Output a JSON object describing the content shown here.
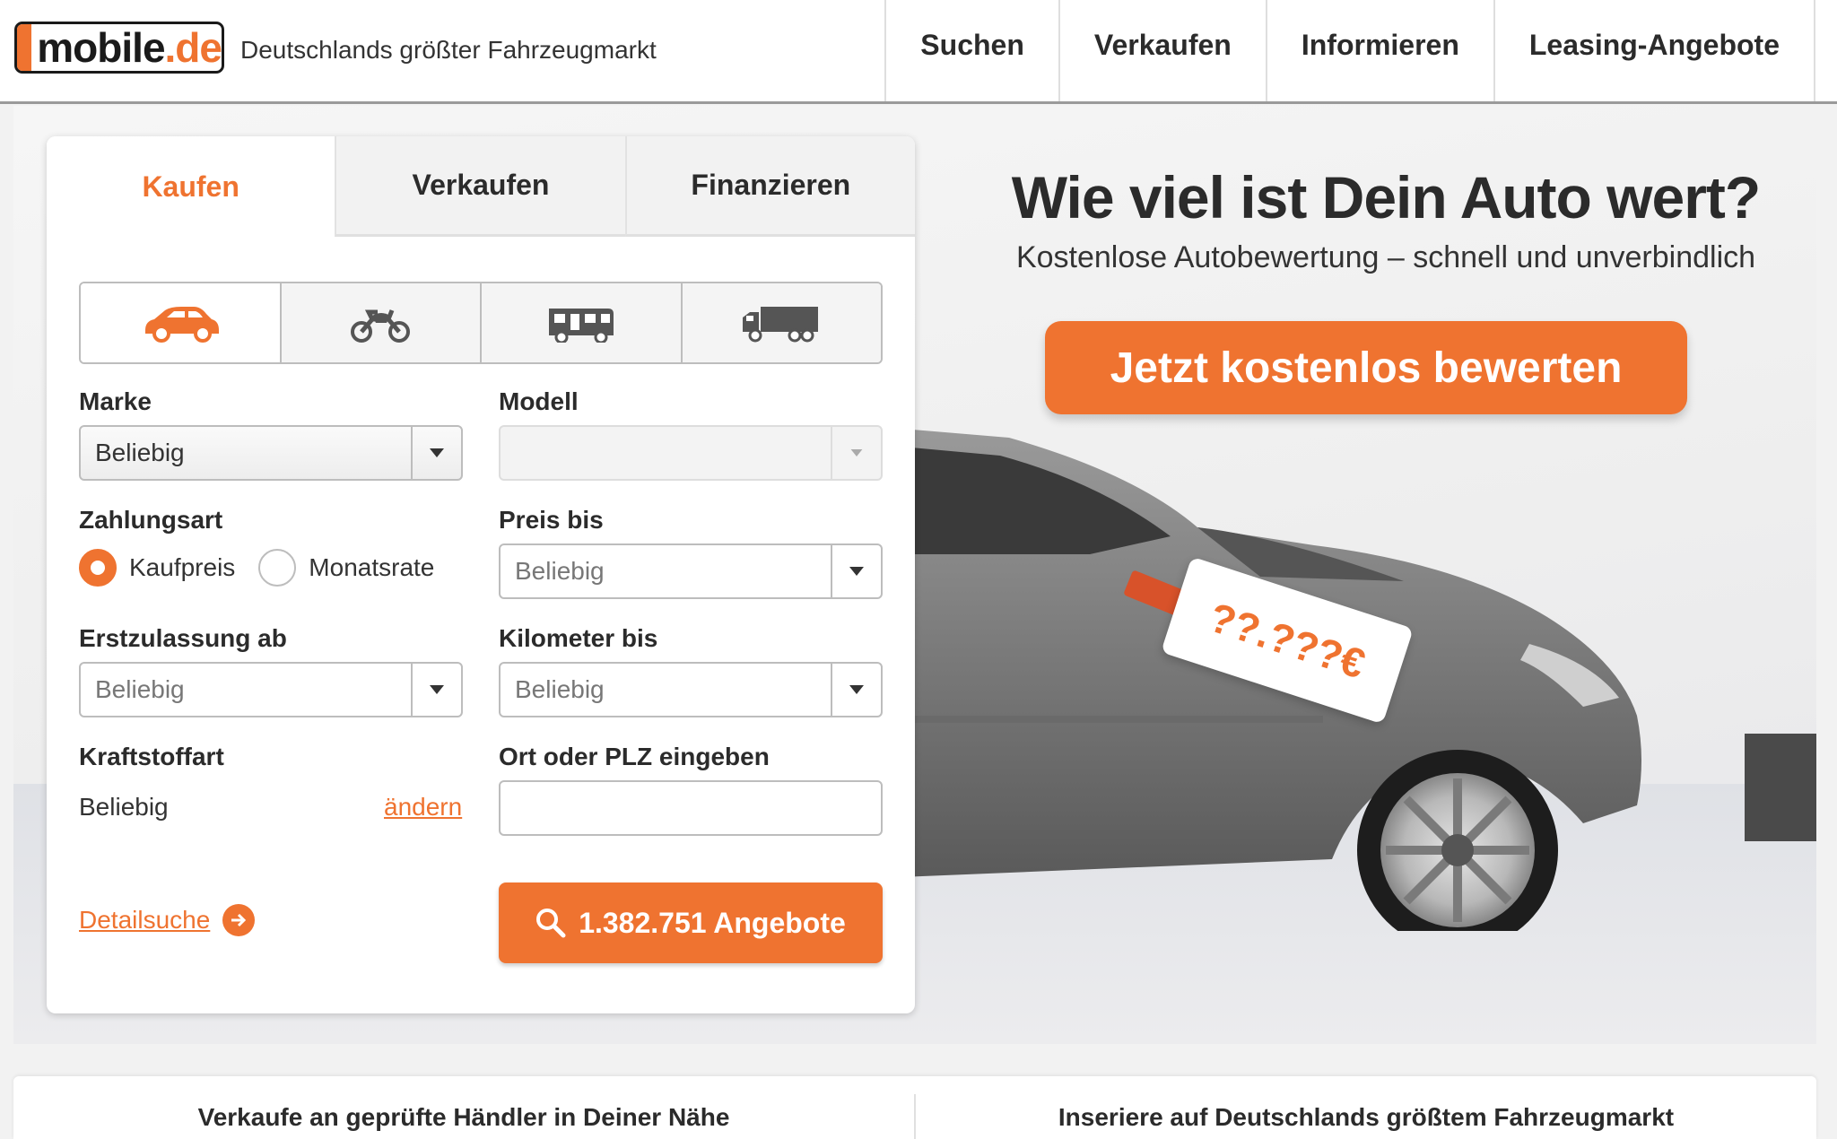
{
  "header": {
    "logo_main": "mobile",
    "logo_dot": ".de",
    "tagline": "Deutschlands größter Fahrzeugmarkt",
    "nav": [
      "Suchen",
      "Verkaufen",
      "Informieren",
      "Leasing-Angebote"
    ]
  },
  "search": {
    "tabs": [
      "Kaufen",
      "Verkaufen",
      "Finanzieren"
    ],
    "active_tab": "Kaufen",
    "vehicle_types": [
      "car-icon",
      "motorcycle-icon",
      "motorhome-icon",
      "truck-icon"
    ],
    "marke": {
      "label": "Marke",
      "value": "Beliebig"
    },
    "modell": {
      "label": "Modell",
      "value": ""
    },
    "zahlungsart": {
      "label": "Zahlungsart",
      "options": [
        "Kaufpreis",
        "Monatsrate"
      ],
      "selected": "Kaufpreis"
    },
    "preis": {
      "label": "Preis bis",
      "value": "Beliebig"
    },
    "erstzulassung": {
      "label": "Erstzulassung ab",
      "value": "Beliebig"
    },
    "kilometer": {
      "label": "Kilometer bis",
      "value": "Beliebig"
    },
    "kraftstoff": {
      "label": "Kraftstoffart",
      "value": "Beliebig",
      "change_link": "ändern"
    },
    "ort": {
      "label": "Ort oder PLZ eingeben",
      "value": ""
    },
    "detail_link": "Detailsuche",
    "submit_label": "1.382.751 Angebote"
  },
  "hero": {
    "title": "Wie viel ist Dein Auto wert?",
    "subtitle": "Kostenlose Autobewertung – schnell und unverbindlich",
    "cta": "Jetzt kostenlos bewerten",
    "price_tag": "??.???€"
  },
  "bottom": {
    "left": "Verkaufe an geprüfte Händler in Deiner Nähe",
    "right": "Inseriere auf Deutschlands größtem Fahrzeugmarkt"
  },
  "colors": {
    "accent": "#ef7330",
    "text": "#2b2b2b",
    "border": "#bdbdbd"
  }
}
